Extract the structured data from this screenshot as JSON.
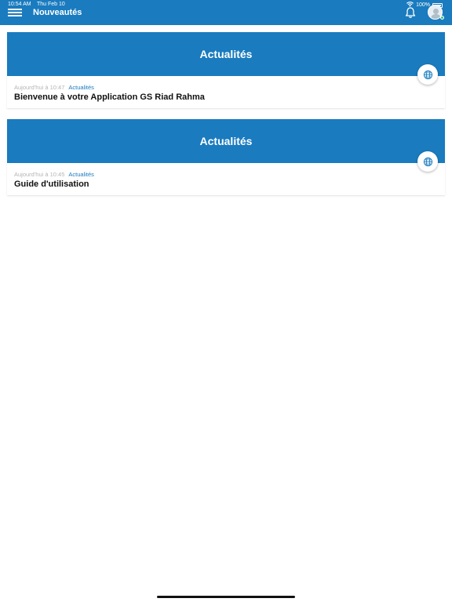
{
  "status_bar": {
    "time": "10:54 AM",
    "date": "Thu Feb 10",
    "battery": "100%"
  },
  "header": {
    "title": "Nouveautés"
  },
  "colors": {
    "brand": "#1a7bbf",
    "online": "#2ecc71"
  },
  "icons": {
    "menu": "hamburger-menu-icon",
    "notifications": "bell-icon",
    "avatar": "user-avatar",
    "card_action": "globe-icon"
  },
  "news": [
    {
      "banner": "Actualités",
      "date": "Aujourd'hui à 10:47",
      "category": "Actualités",
      "title": "Bienvenue à votre Application GS Riad Rahma"
    },
    {
      "banner": "Actualités",
      "date": "Aujourd'hui à 10:45",
      "category": "Actualités",
      "title": "Guide d'utilisation"
    }
  ]
}
